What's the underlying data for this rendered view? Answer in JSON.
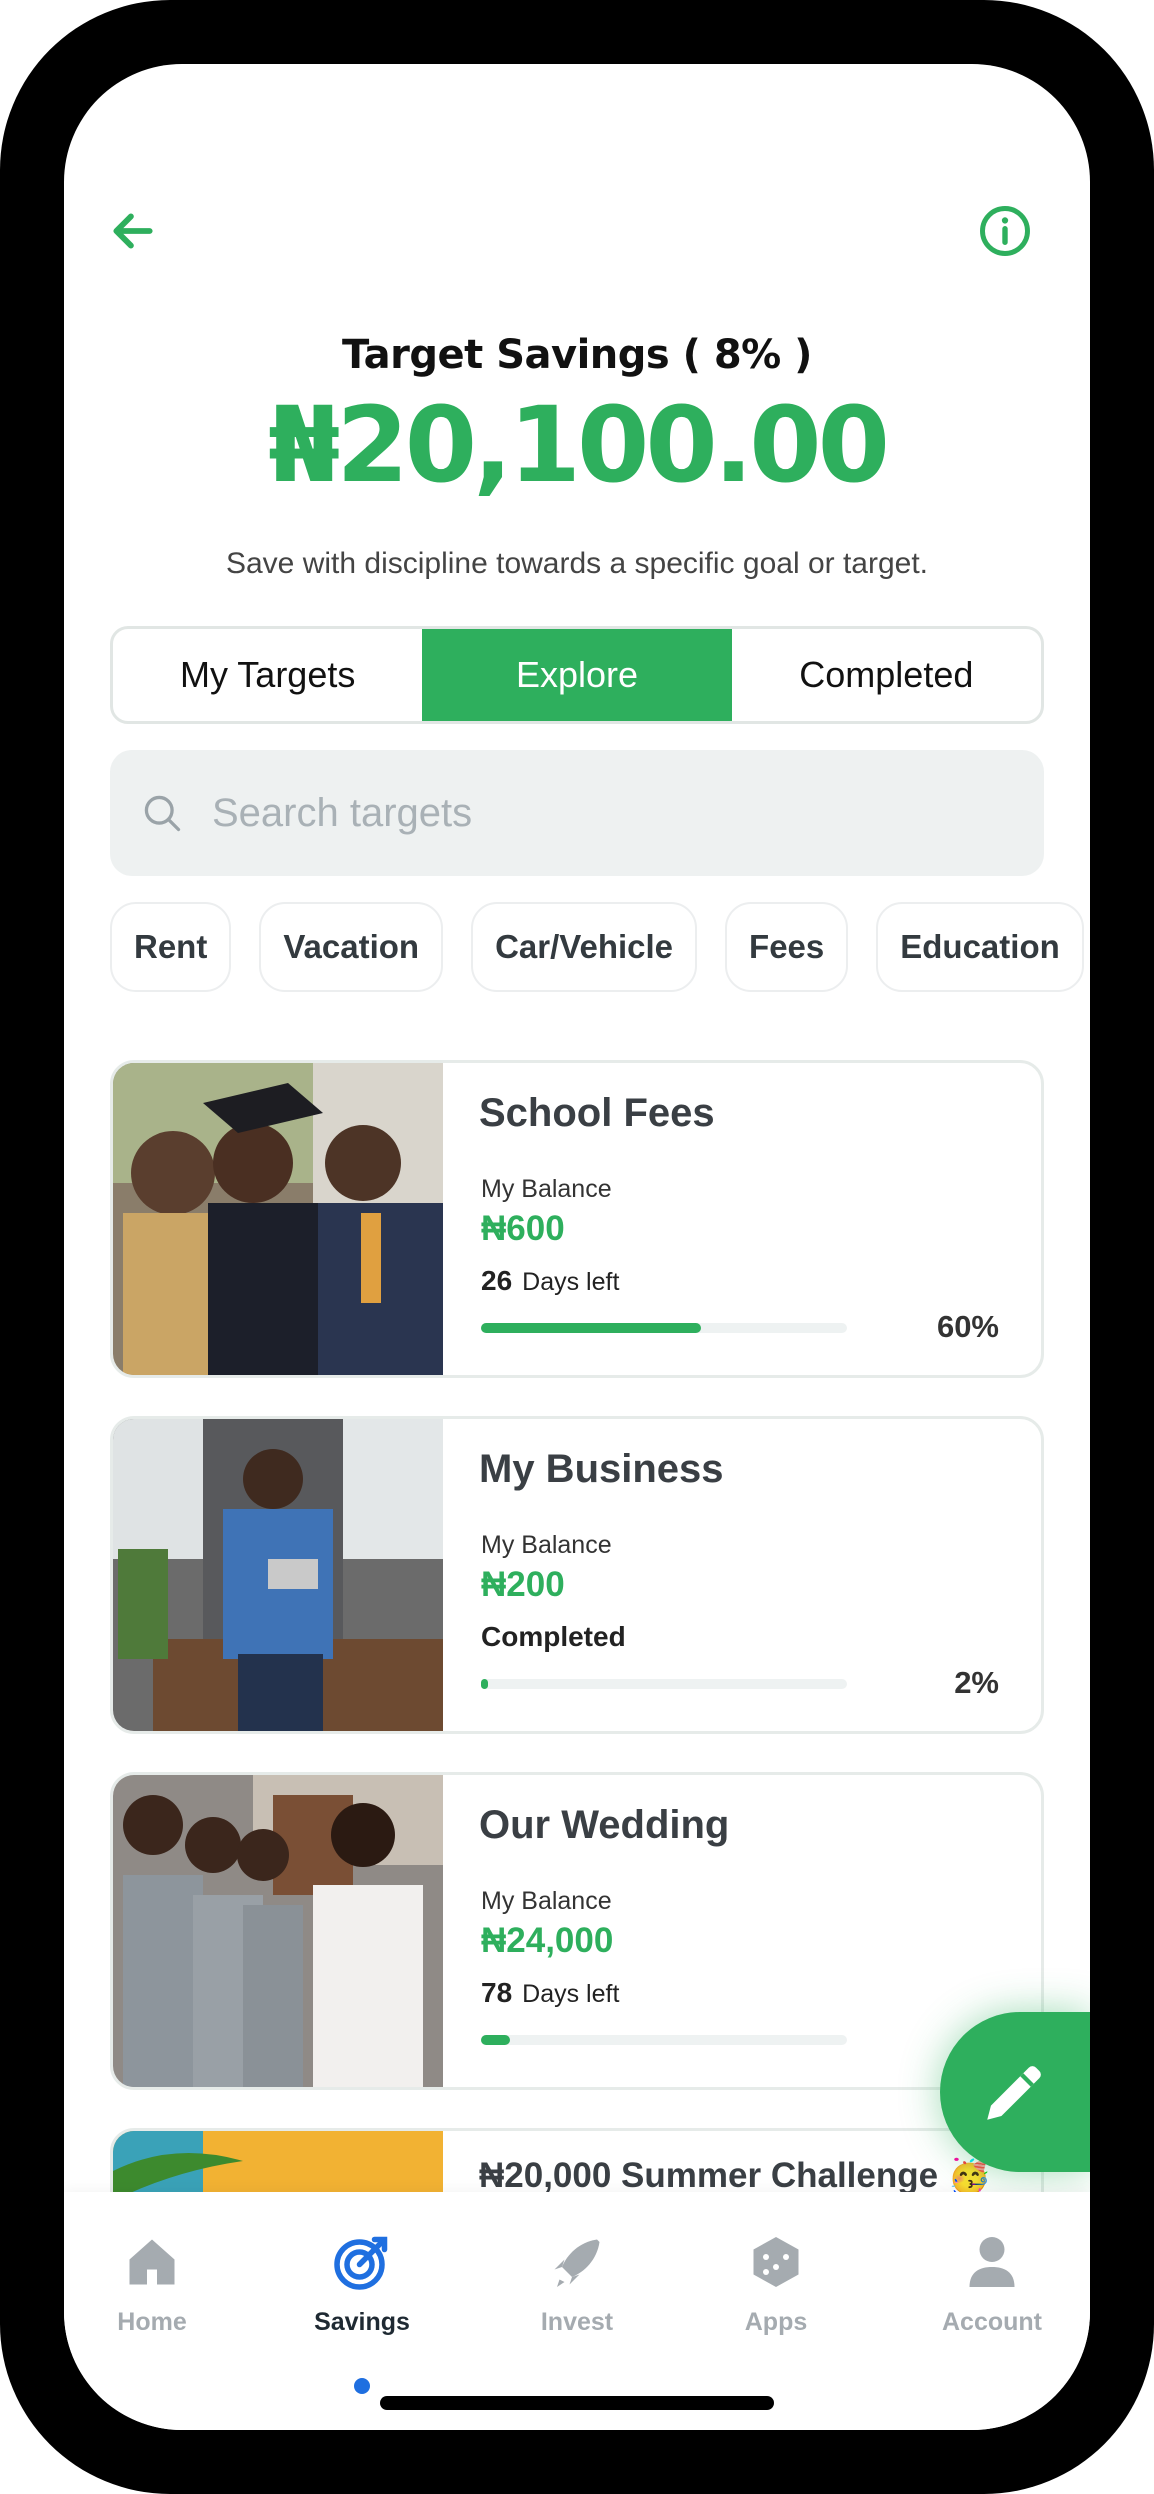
{
  "header": {
    "title": "Target Savings ( 8% )",
    "amount": "₦20,100.00",
    "subtitle": "Save with discipline towards a specific goal or target."
  },
  "tabs": [
    {
      "label": "My Targets",
      "active": false
    },
    {
      "label": "Explore",
      "active": true
    },
    {
      "label": "Completed",
      "active": false
    }
  ],
  "search": {
    "placeholder": "Search targets"
  },
  "chips": [
    "Rent",
    "Vacation",
    "Car/Vehicle",
    "Fees",
    "Education"
  ],
  "cards": [
    {
      "title": "School Fees",
      "balance_label": "My Balance",
      "balance": "₦600",
      "days": "26",
      "days_label": "Days left",
      "progress": 0.6,
      "percent": "60%"
    },
    {
      "title": "My Business",
      "balance_label": "My Balance",
      "balance": "₦200",
      "status": "Completed",
      "progress": 0.02,
      "percent": "2%"
    },
    {
      "title": "Our Wedding",
      "balance_label": "My Balance",
      "balance": "₦24,000",
      "days": "78",
      "days_label": "Days left",
      "progress": 0.08,
      "percent": ""
    },
    {
      "title": "₦20,000 Summer Challenge 🥳"
    }
  ],
  "nav": [
    {
      "label": "Home",
      "icon": "home-icon",
      "active": false
    },
    {
      "label": "Savings",
      "icon": "target-icon",
      "active": true
    },
    {
      "label": "Invest",
      "icon": "rocket-icon",
      "active": false
    },
    {
      "label": "Apps",
      "icon": "cube-icon",
      "active": false
    },
    {
      "label": "Account",
      "icon": "user-icon",
      "active": false
    }
  ],
  "colors": {
    "accent": "#2eaf5d",
    "active_dot": "#1f6fe0",
    "inactive_nav": "#a5abb0"
  }
}
